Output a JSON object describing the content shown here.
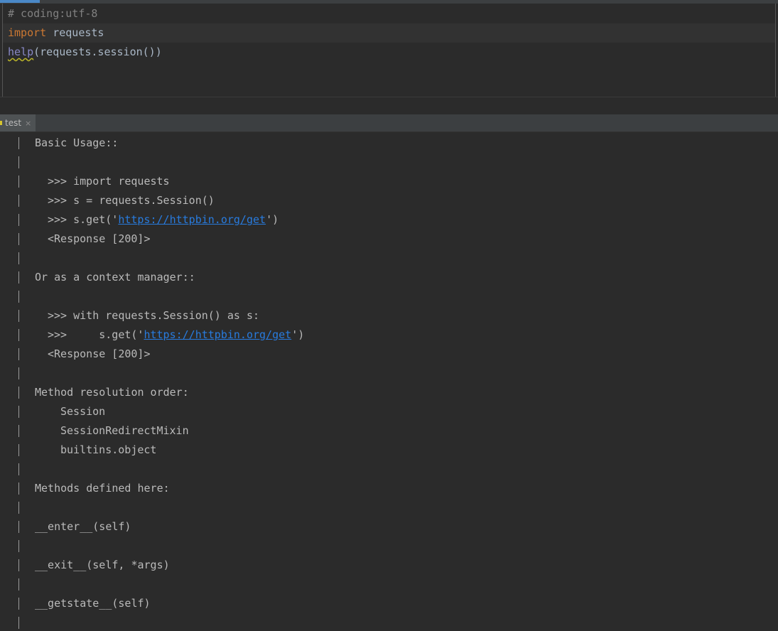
{
  "editor": {
    "lines": [
      {
        "parts": [
          {
            "text": "# coding:utf-8",
            "cls": "tok-comment"
          }
        ]
      },
      {
        "parts": [
          {
            "text": "import",
            "cls": "tok-keyword"
          },
          {
            "text": " requests",
            "cls": "tok-plain"
          }
        ]
      },
      {
        "parts": [
          {
            "text": "help",
            "cls": "tok-help"
          },
          {
            "text": "(requests.session())",
            "cls": "tok-plain"
          }
        ]
      }
    ]
  },
  "run_panel": {
    "tab_label": "test",
    "close_glyph": "×"
  },
  "console": {
    "lines": [
      {
        "pipe": true,
        "indent": 1,
        "parts": [
          {
            "text": "Basic Usage::"
          }
        ]
      },
      {
        "pipe": true,
        "indent": 0,
        "parts": []
      },
      {
        "pipe": true,
        "indent": 2,
        "parts": [
          {
            "text": ">>> import requests"
          }
        ]
      },
      {
        "pipe": true,
        "indent": 2,
        "parts": [
          {
            "text": ">>> s = requests.Session()"
          }
        ]
      },
      {
        "pipe": true,
        "indent": 2,
        "parts": [
          {
            "text": ">>> s.get('"
          },
          {
            "text": "https://httpbin.org/get",
            "link": true
          },
          {
            "text": "')"
          }
        ]
      },
      {
        "pipe": true,
        "indent": 2,
        "parts": [
          {
            "text": "<Response [200]>"
          }
        ]
      },
      {
        "pipe": true,
        "indent": 0,
        "parts": []
      },
      {
        "pipe": true,
        "indent": 1,
        "parts": [
          {
            "text": "Or as a context manager::"
          }
        ]
      },
      {
        "pipe": true,
        "indent": 0,
        "parts": []
      },
      {
        "pipe": true,
        "indent": 2,
        "parts": [
          {
            "text": ">>> with requests.Session() as s:"
          }
        ]
      },
      {
        "pipe": true,
        "indent": 2,
        "parts": [
          {
            "text": ">>>     s.get('"
          },
          {
            "text": "https://httpbin.org/get",
            "link": true
          },
          {
            "text": "')"
          }
        ]
      },
      {
        "pipe": true,
        "indent": 2,
        "parts": [
          {
            "text": "<Response [200]>"
          }
        ]
      },
      {
        "pipe": true,
        "indent": 0,
        "parts": []
      },
      {
        "pipe": true,
        "indent": 1,
        "parts": [
          {
            "text": "Method resolution order:"
          }
        ]
      },
      {
        "pipe": true,
        "indent": 3,
        "parts": [
          {
            "text": "Session"
          }
        ]
      },
      {
        "pipe": true,
        "indent": 3,
        "parts": [
          {
            "text": "SessionRedirectMixin"
          }
        ]
      },
      {
        "pipe": true,
        "indent": 3,
        "parts": [
          {
            "text": "builtins.object"
          }
        ]
      },
      {
        "pipe": true,
        "indent": 0,
        "parts": []
      },
      {
        "pipe": true,
        "indent": 1,
        "parts": [
          {
            "text": "Methods defined here:"
          }
        ]
      },
      {
        "pipe": true,
        "indent": 0,
        "parts": []
      },
      {
        "pipe": true,
        "indent": 1,
        "parts": [
          {
            "text": "__enter__(self)"
          }
        ]
      },
      {
        "pipe": true,
        "indent": 0,
        "parts": []
      },
      {
        "pipe": true,
        "indent": 1,
        "parts": [
          {
            "text": "__exit__(self, *args)"
          }
        ]
      },
      {
        "pipe": true,
        "indent": 0,
        "parts": []
      },
      {
        "pipe": true,
        "indent": 1,
        "parts": [
          {
            "text": "__getstate__(self)"
          }
        ]
      },
      {
        "pipe": true,
        "indent": 0,
        "parts": []
      }
    ]
  }
}
